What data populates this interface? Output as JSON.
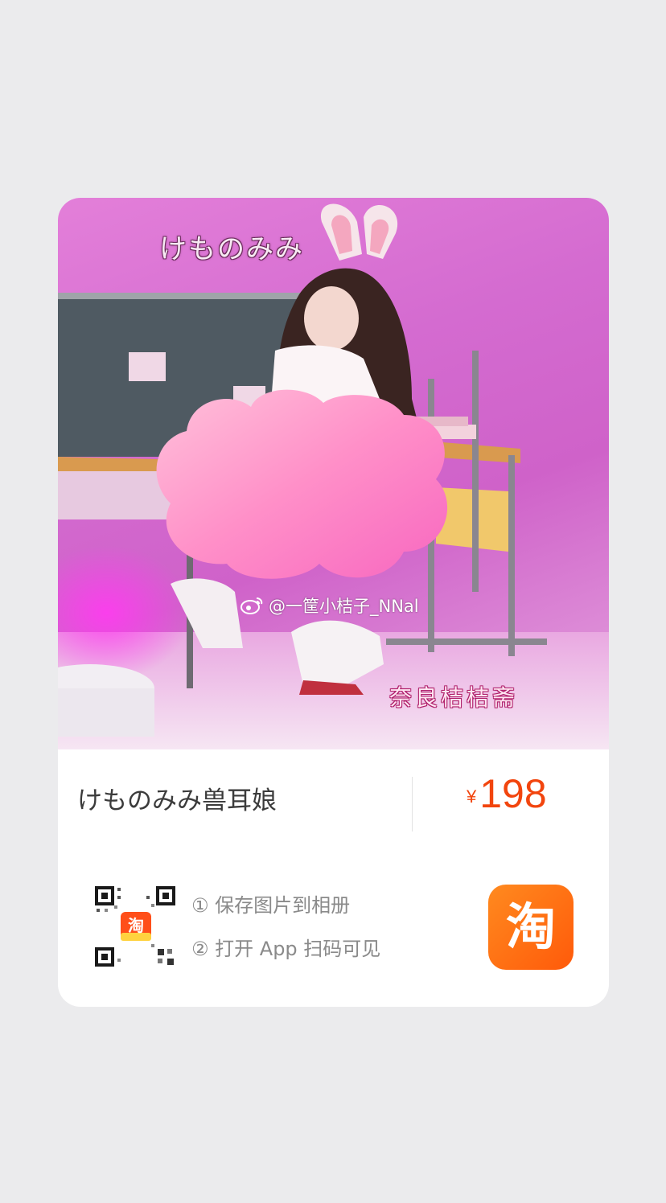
{
  "product": {
    "title": "けものみみ兽耳娘",
    "price_currency": "¥",
    "price_amount": "198"
  },
  "image": {
    "title_text": "けものみみ",
    "watermark_text": "@一筐小桔子_NNal",
    "signature_text": "奈良桔桔斋"
  },
  "instructions": {
    "step1": "① 保存图片到相册",
    "step2": "② 打开 App 扫码可见"
  },
  "brand": {
    "logo_glyph": "淘",
    "qr_badge_glyph": "淘"
  },
  "colors": {
    "price": "#f2450e",
    "logo_orange": "#ff5a0a",
    "background": "#ebebed",
    "photo_pink": "#d46bd0"
  }
}
